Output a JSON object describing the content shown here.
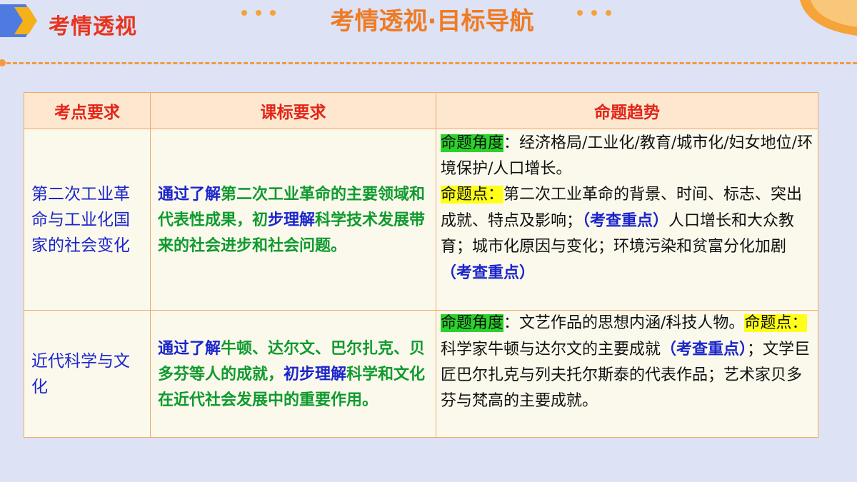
{
  "header": {
    "section_label": "考情透视",
    "title": "考情透视·目标导航"
  },
  "colors": {
    "accent_red": "#e8331e",
    "accent_orange": "#ee7b24",
    "topic_blue": "#1b25cc",
    "std_green": "#0f9a2e",
    "highlight_green": "#2ad32a",
    "highlight_yellow": "#ffff1a"
  },
  "table": {
    "headers": [
      "考点要求",
      "课标要求",
      "命题趋势"
    ],
    "rows": [
      {
        "topic": "第二次工业革命与工业化国家的社会变化",
        "std_prefix": "通过了解",
        "std_main": "第二次工业革命的主要领域和代表性成果，初",
        "std_verb": "步理解",
        "std_rest": "科学技术发展带来的社会进步和社会问题。",
        "angle_label": "命题角度",
        "angle_text": "：经济格局/工业化/教育/城市化/妇女地位/环境保护/人口增长。",
        "point_label": "命题点：",
        "point_text_1": "第二次工业革命的背景、时间、标志、突出成就、特点及影响；",
        "key_1": "（考查重点）",
        "point_text_2": "人口增长和大众教育；城市化原因与变化；环境污染和贫富分化加剧",
        "key_2": "（考查重点）"
      },
      {
        "topic": "近代科学与文化",
        "std_prefix": "通过了解",
        "std_main": "牛顿、达尔文、巴尔扎克、贝多芬等人的成就，",
        "std_verb": "初步理解",
        "std_rest": "科学和文化在近代社会发展中的重要作用。",
        "angle_label": "命题角度",
        "angle_text": "：文艺作品的思想内涵/科技人物。",
        "point_label": "命题点：",
        "point_text_1": "科学家牛顿与达尔文的主要成就",
        "key_1": "（考查重点）",
        "point_text_2": "；文学巨匠巴尔扎克与列夫托尔斯泰的代表作品；艺术家贝多芬与梵高的主要成就。"
      }
    ]
  }
}
